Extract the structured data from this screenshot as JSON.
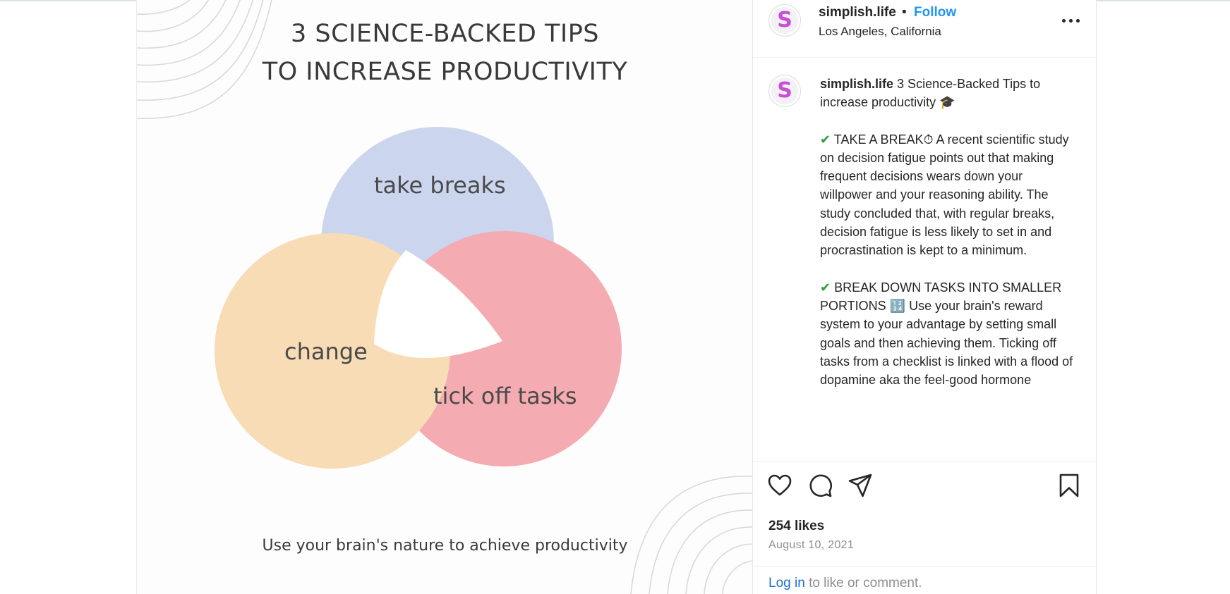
{
  "post": {
    "image": {
      "title_line1": "3 SCIENCE-BACKED TIPS",
      "title_line2": "TO INCREASE PRODUCTIVITY",
      "venn": {
        "label_top": "take breaks",
        "label_left": "change",
        "label_right": "tick off tasks",
        "colors": {
          "top": "#cbd5ee",
          "left": "#f8dcb5",
          "right": "#f4abb1"
        }
      },
      "subtitle": "Use your brain's nature to achieve productivity"
    },
    "header": {
      "username": "simplish.life",
      "separator": "•",
      "follow_label": "Follow",
      "location": "Los Angeles, California",
      "avatar_letter": "S"
    },
    "caption": {
      "username": "simplish.life",
      "title": "3 Science-Backed Tips to increase productivity 🎓",
      "tip1_check": "✔",
      "tip1": "TAKE A BREAK⏱ A recent scientific study on decision fatigue points out that making frequent decisions wears down your willpower and your reasoning ability. The study concluded that, with regular breaks, decision fatigue is less likely to set in and procrastination is kept to a minimum.",
      "tip2_check": "✔",
      "tip2": "BREAK DOWN TASKS INTO SMALLER PORTIONS 🔢 Use your brain's reward system to your advantage by setting small goals and then achieving them. Ticking off tasks from a checklist is linked with a flood of dopamine aka the feel-good hormone"
    },
    "actions": {
      "icons": [
        "heart-icon",
        "comment-icon",
        "share-icon",
        "bookmark-icon"
      ]
    },
    "likes": "254 likes",
    "date": "August 10, 2021",
    "login": {
      "link": "Log in",
      "text": "to like or comment."
    },
    "colors": {
      "follow": "#2196f3",
      "link": "#1f6fd1",
      "avatar_letter": "#c64fd6"
    }
  }
}
